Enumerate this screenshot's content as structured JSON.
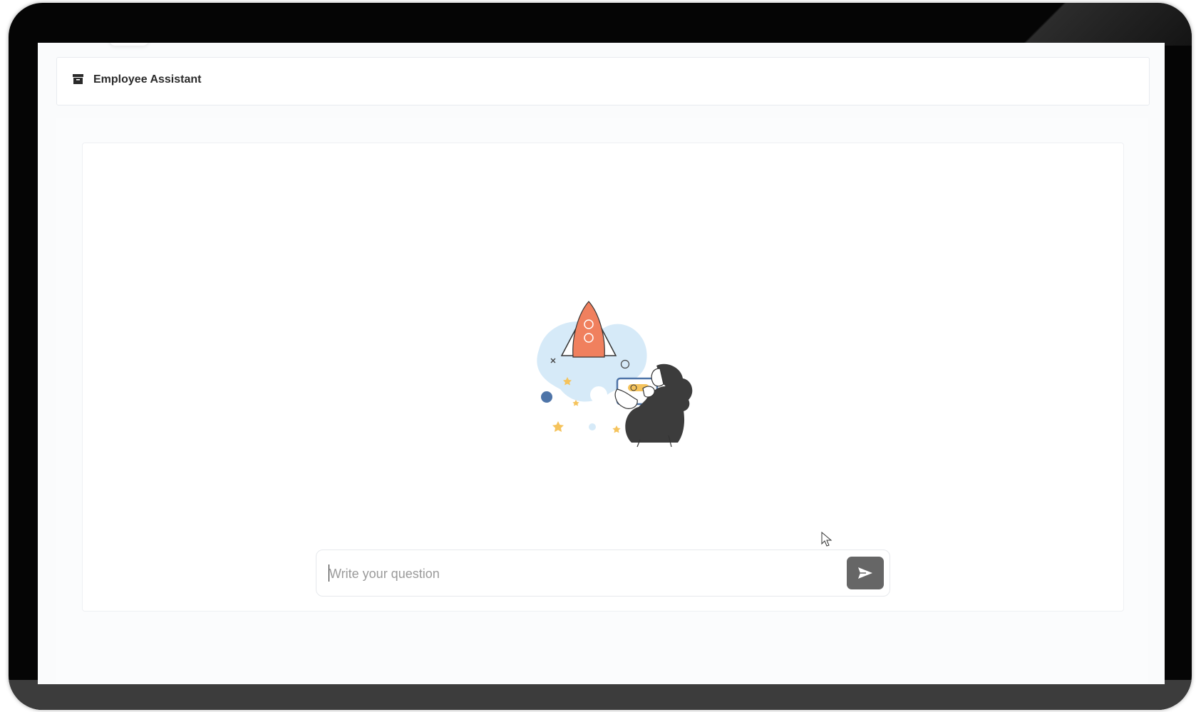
{
  "header": {
    "title": "Employee Assistant",
    "icon": "archive-icon"
  },
  "chat": {
    "illustration": "rocket-and-woman-illustration",
    "input": {
      "value": "",
      "placeholder": "Write your question"
    },
    "send_icon": "send-icon"
  },
  "colors": {
    "accent_rocket": "#f0805e",
    "send_button": "#666666",
    "panel_border": "#eef0f3",
    "light_blue": "#d6eaf8",
    "star_yellow": "#f5c35c",
    "dot_blue": "#4e74a8"
  }
}
